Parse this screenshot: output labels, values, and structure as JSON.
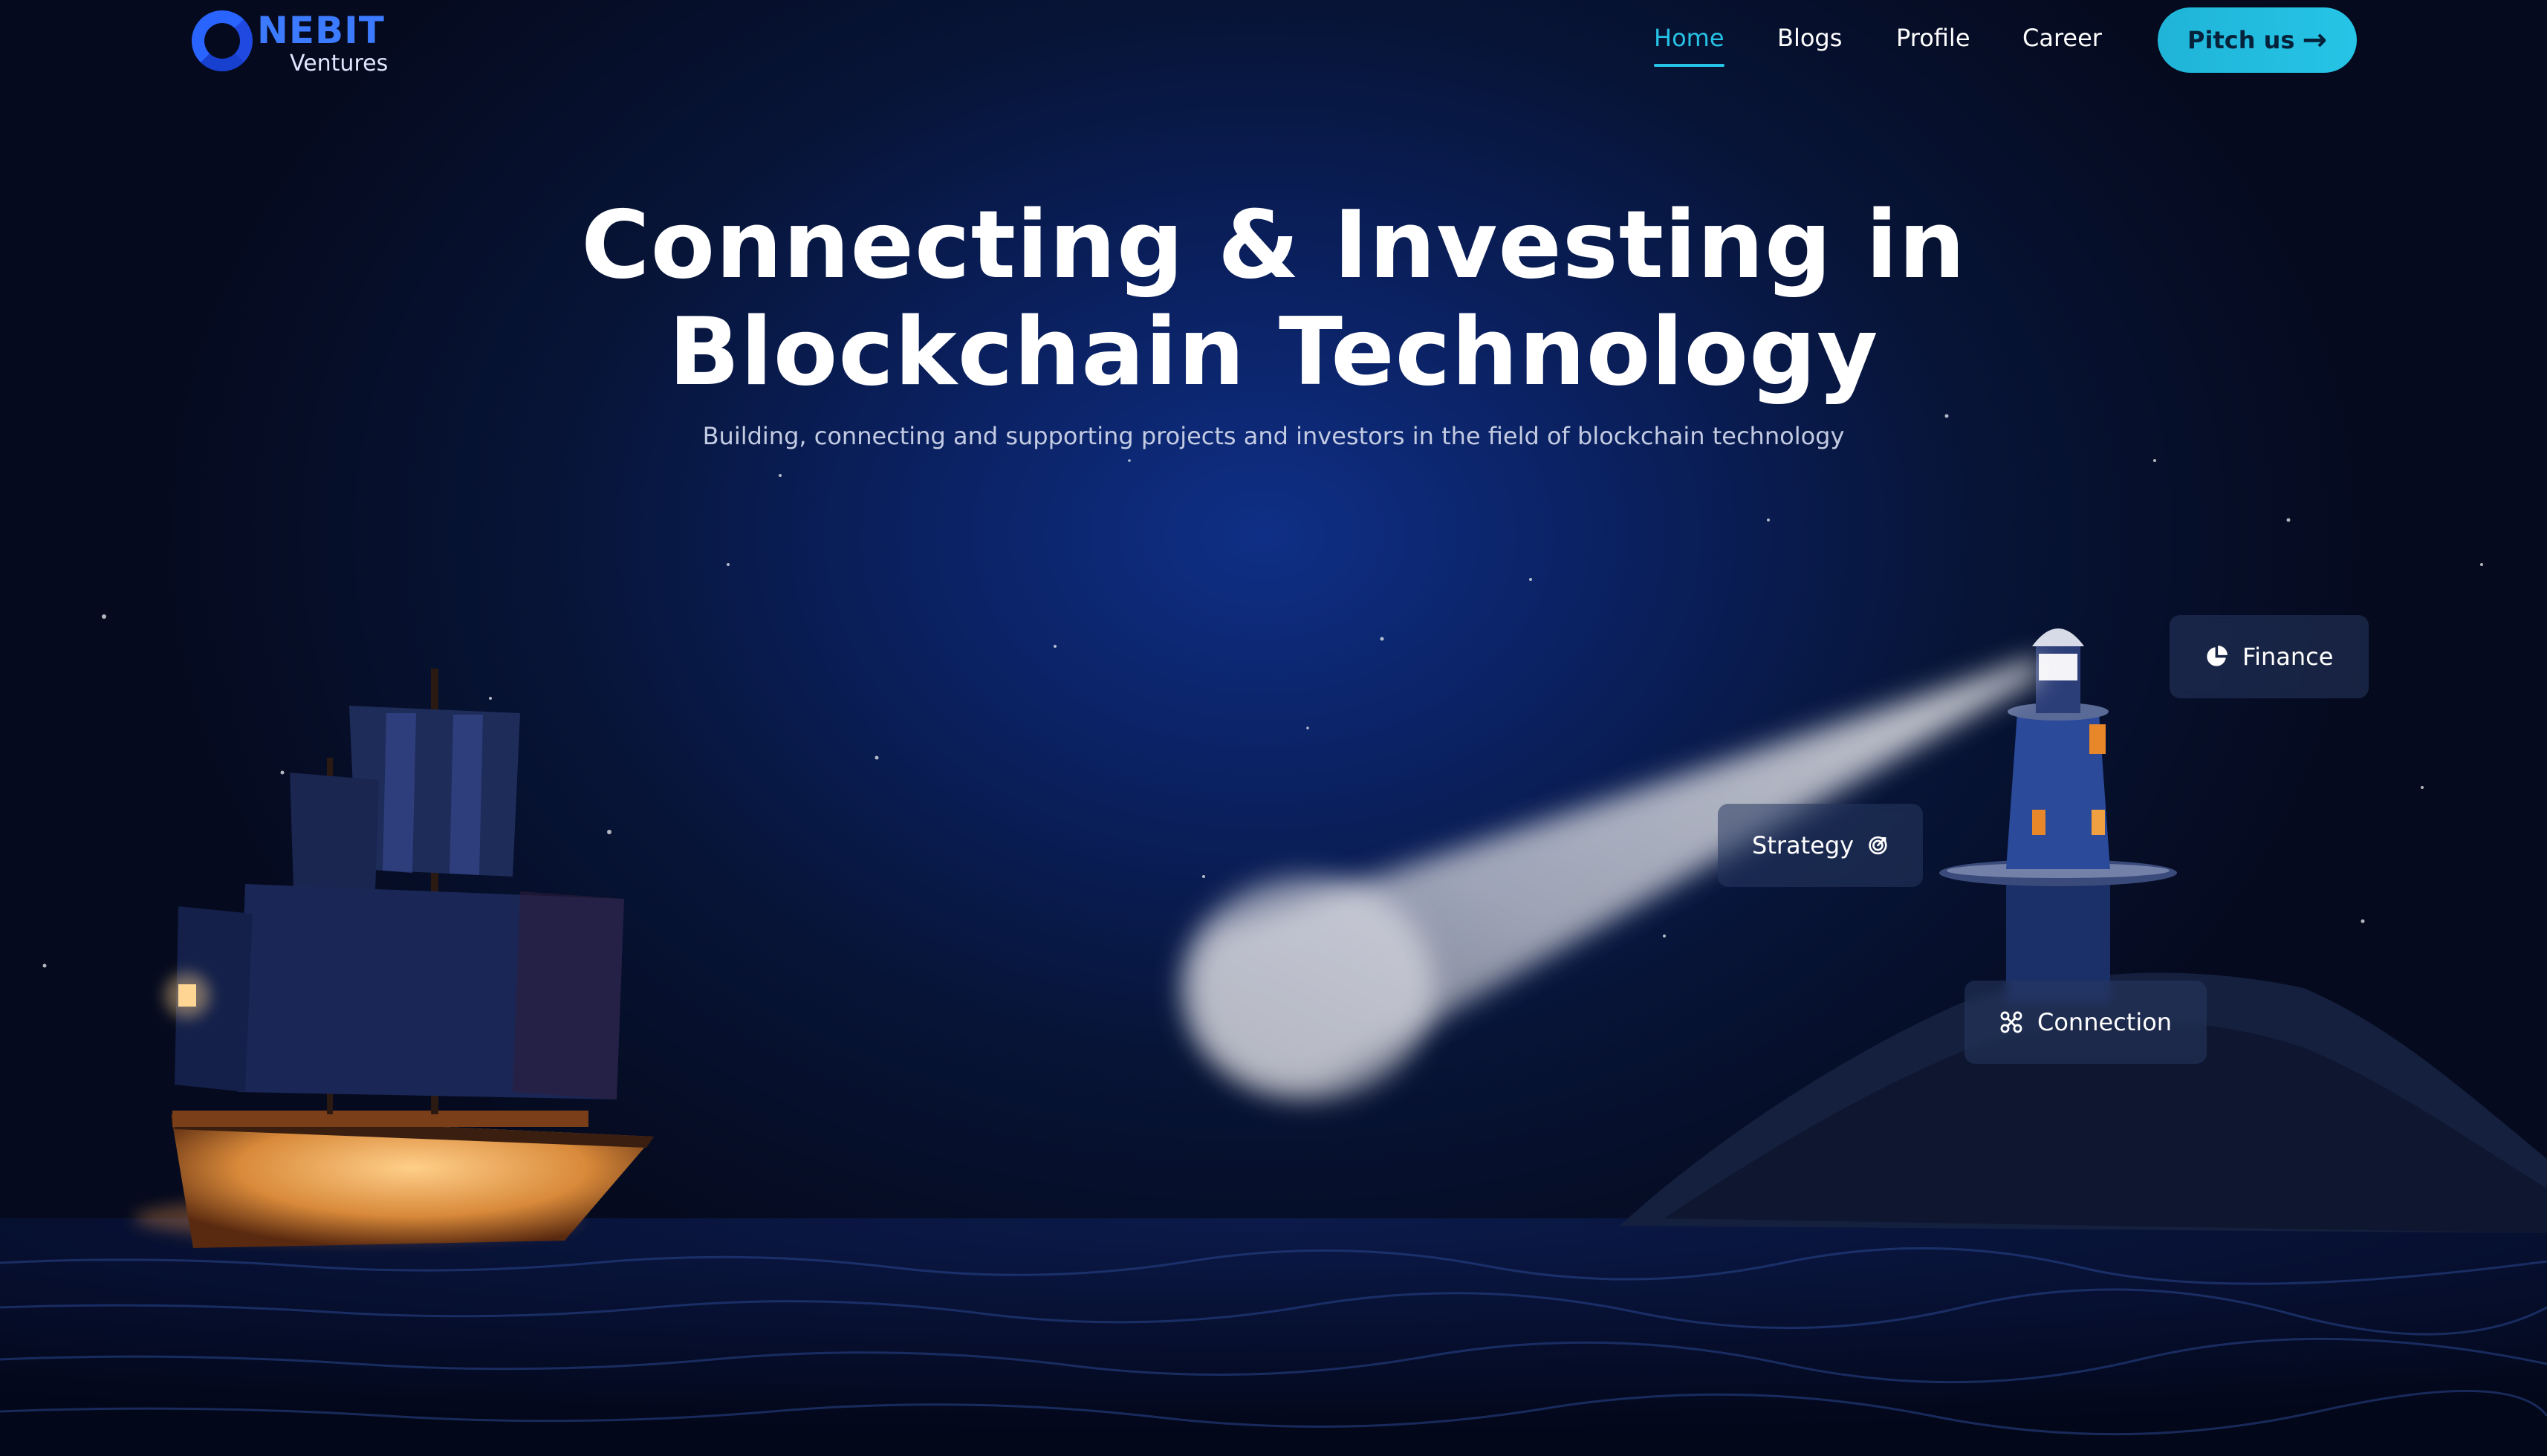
{
  "brand": {
    "name": "NEBIT",
    "tagline": "Ventures"
  },
  "nav": {
    "items": [
      {
        "label": "Home",
        "active": true
      },
      {
        "label": "Blogs",
        "active": false
      },
      {
        "label": "Profile",
        "active": false
      },
      {
        "label": "Career",
        "active": false
      }
    ],
    "cta_label": "Pitch us",
    "cta_icon": "arrow-right-icon"
  },
  "hero": {
    "title_line1": "Connecting & Investing in",
    "title_line2": "Blockchain Technology",
    "subtitle": "Building, connecting and supporting projects and investors in the field of blockchain technology"
  },
  "chips": {
    "finance": {
      "label": "Finance",
      "icon": "pie-chart-icon"
    },
    "strategy": {
      "label": "Strategy",
      "icon": "target-icon"
    },
    "connection": {
      "label": "Connection",
      "icon": "nodes-icon"
    }
  },
  "colors": {
    "accent": "#27c3e6",
    "brand_blue": "#2a64ff",
    "background": "#050a1e"
  }
}
